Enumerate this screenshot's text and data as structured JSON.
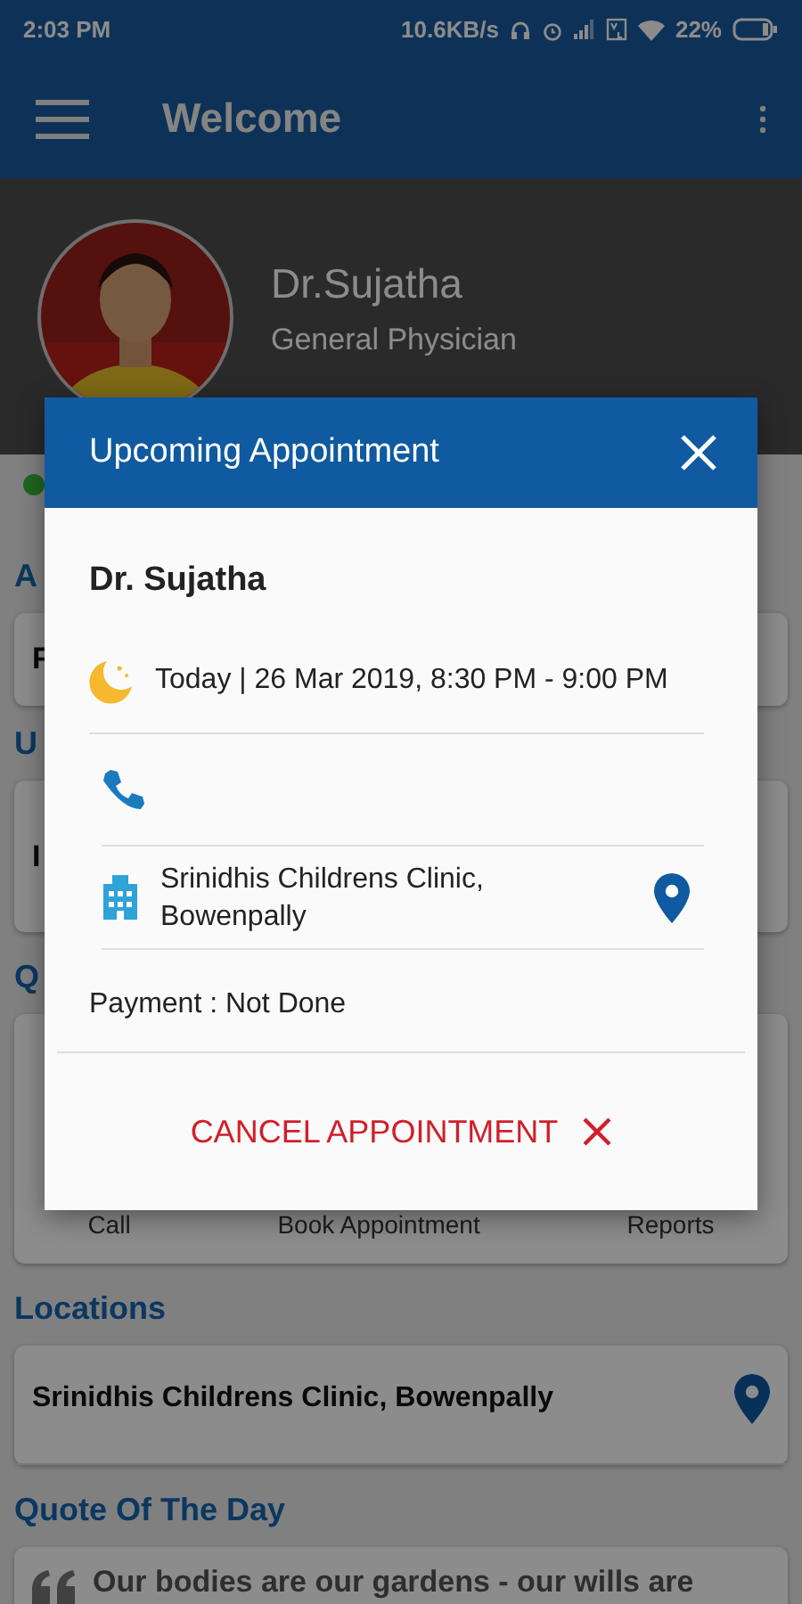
{
  "status_bar": {
    "time": "2:03 PM",
    "speed": "10.6KB/s",
    "battery": "22%"
  },
  "app_bar": {
    "title": "Welcome"
  },
  "profile": {
    "name": "Dr.Sujatha",
    "specialty": "General Physician",
    "online": true
  },
  "sections": [
    {
      "kind": "row",
      "heading": "A",
      "text": "F"
    },
    {
      "kind": "row",
      "heading": "U",
      "text": "I"
    },
    {
      "kind": "actions",
      "heading": "Q",
      "actions": [
        "Call",
        "Book Appointment",
        "Reports"
      ]
    },
    {
      "kind": "location",
      "heading": "Locations",
      "text": "Srinidhis Childrens Clinic, Bowenpally"
    },
    {
      "kind": "quote",
      "heading": "Quote Of The Day",
      "text": "Our bodies are our gardens - our wills are"
    }
  ],
  "dialog": {
    "title": "Upcoming Appointment",
    "doctor": "Dr. Sujatha",
    "time": "Today | 26 Mar 2019, 8:30 PM - 9:00 PM",
    "clinic": "Srinidhis Childrens Clinic, Bowenpally",
    "payment": "Payment : Not Done",
    "cancel": "CANCEL APPOINTMENT"
  }
}
